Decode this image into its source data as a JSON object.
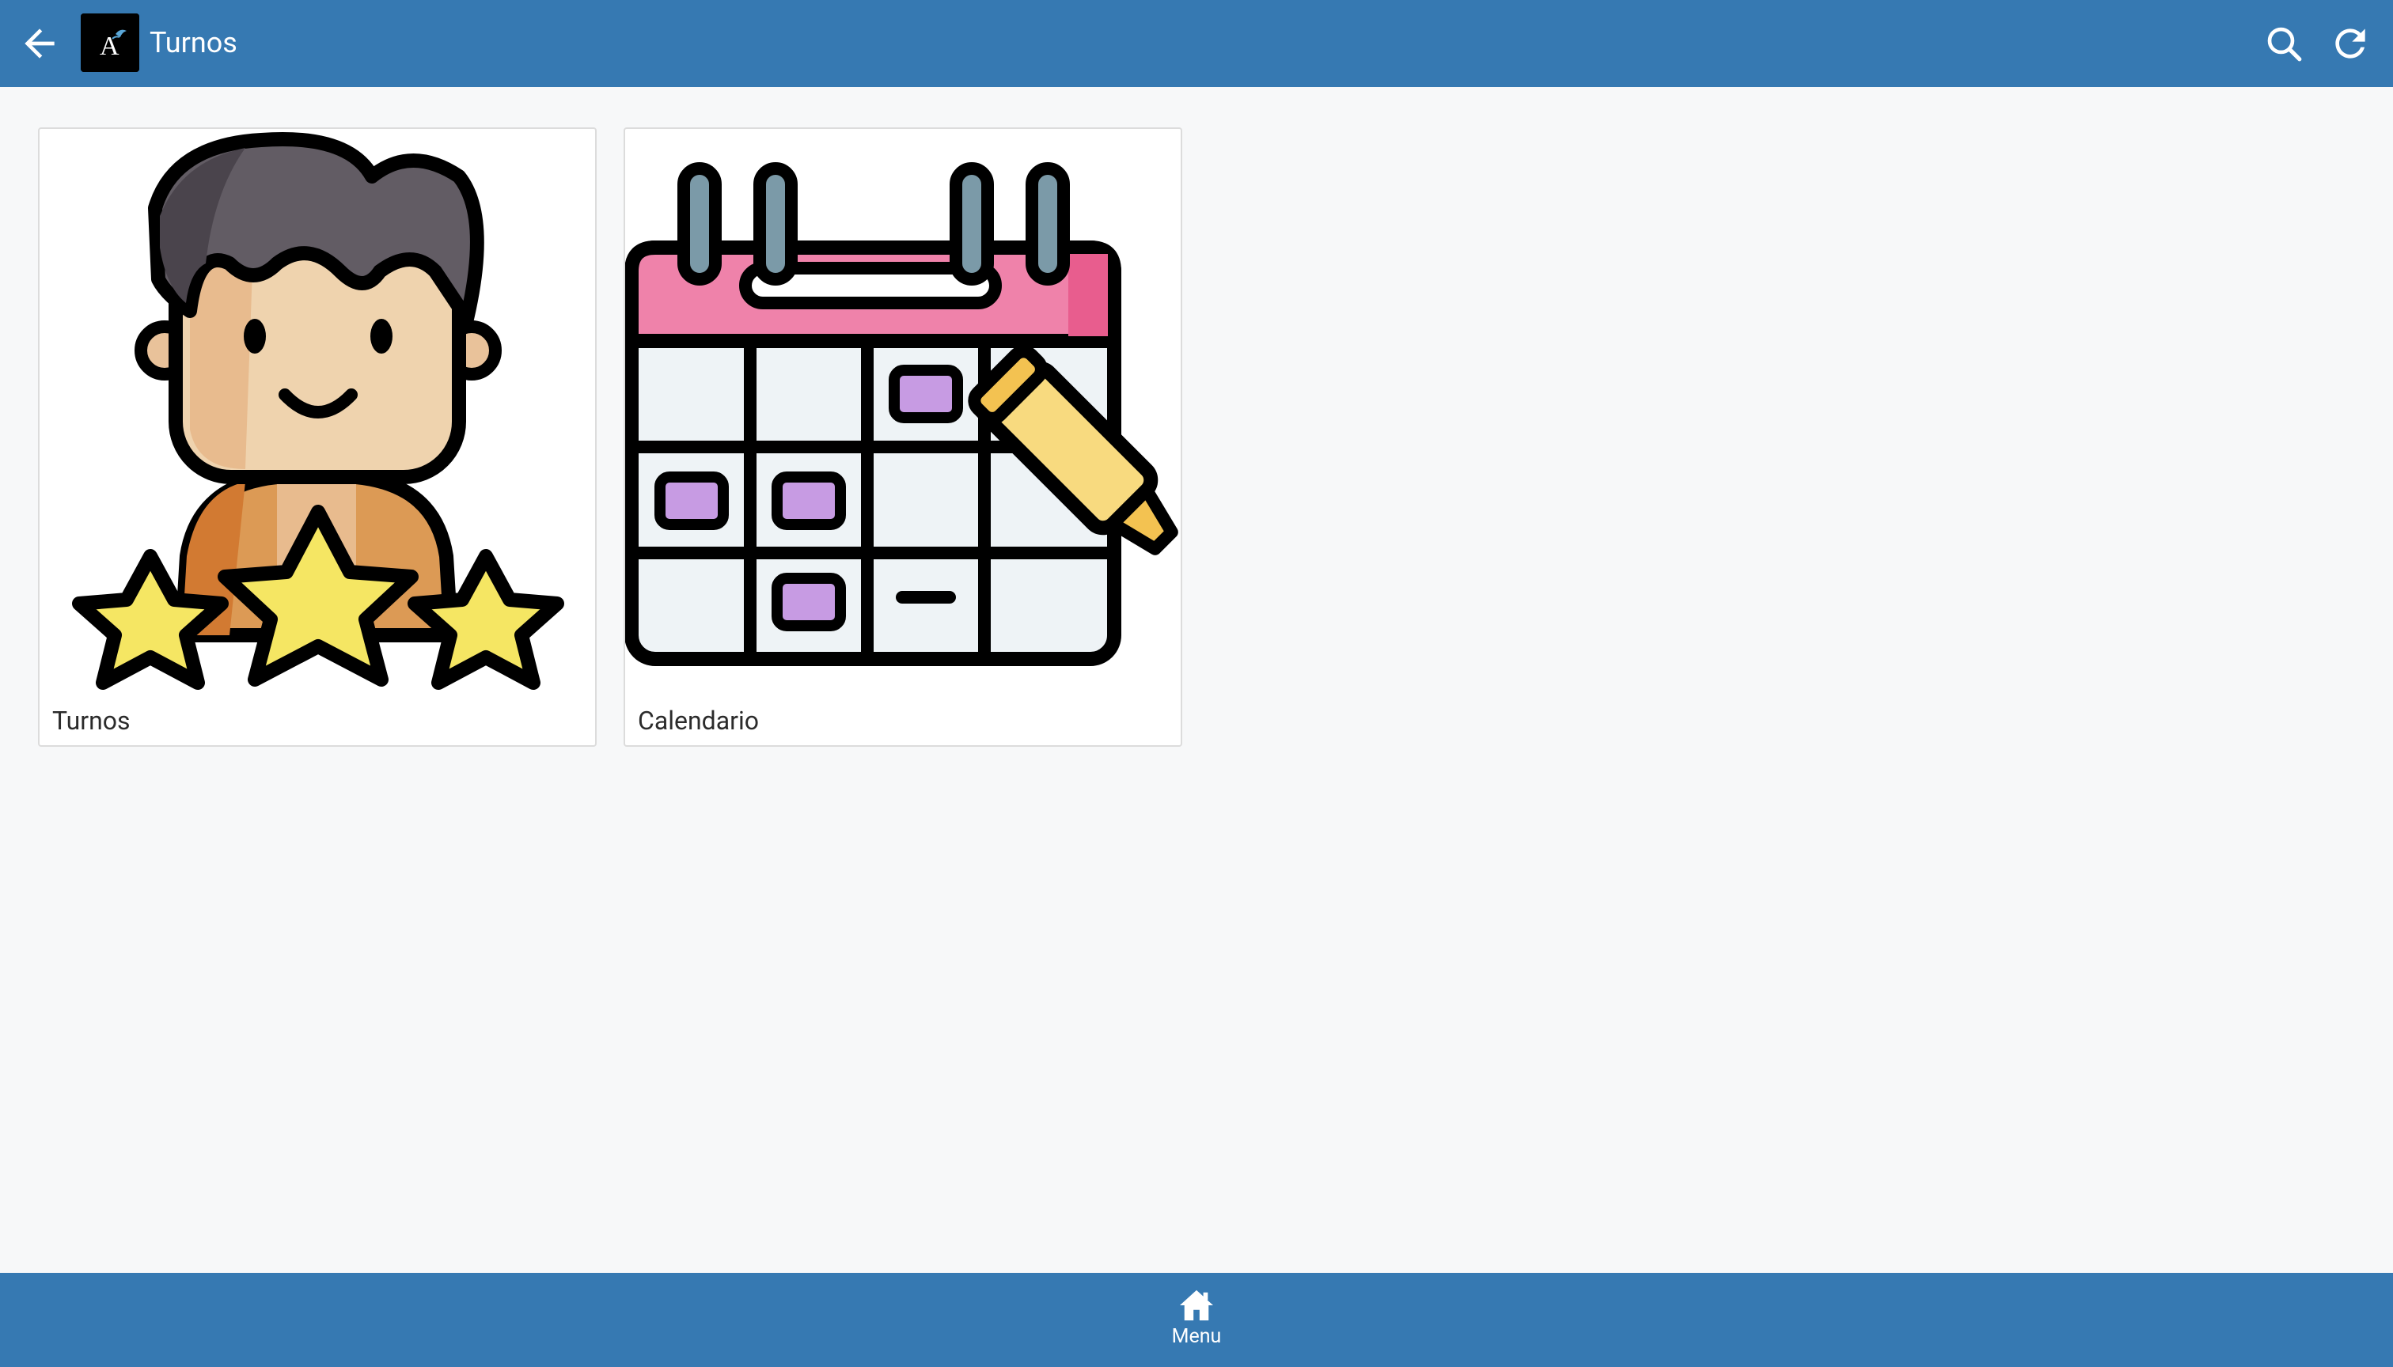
{
  "header": {
    "title": "Turnos",
    "back_icon": "arrow-left-icon",
    "logo_icon": "app-logo",
    "actions": [
      "search-icon",
      "refresh-icon"
    ]
  },
  "main": {
    "cards": [
      {
        "label": "Turnos",
        "icon": "user-rating-stars-illustration"
      },
      {
        "label": "Calendario",
        "icon": "calendar-marker-illustration"
      }
    ]
  },
  "bottom_nav": {
    "items": [
      {
        "label": "Menu",
        "icon": "home-icon"
      }
    ]
  },
  "colors": {
    "appbar": "#3679b2",
    "background": "#f7f8f9",
    "card": "#ffffff"
  }
}
